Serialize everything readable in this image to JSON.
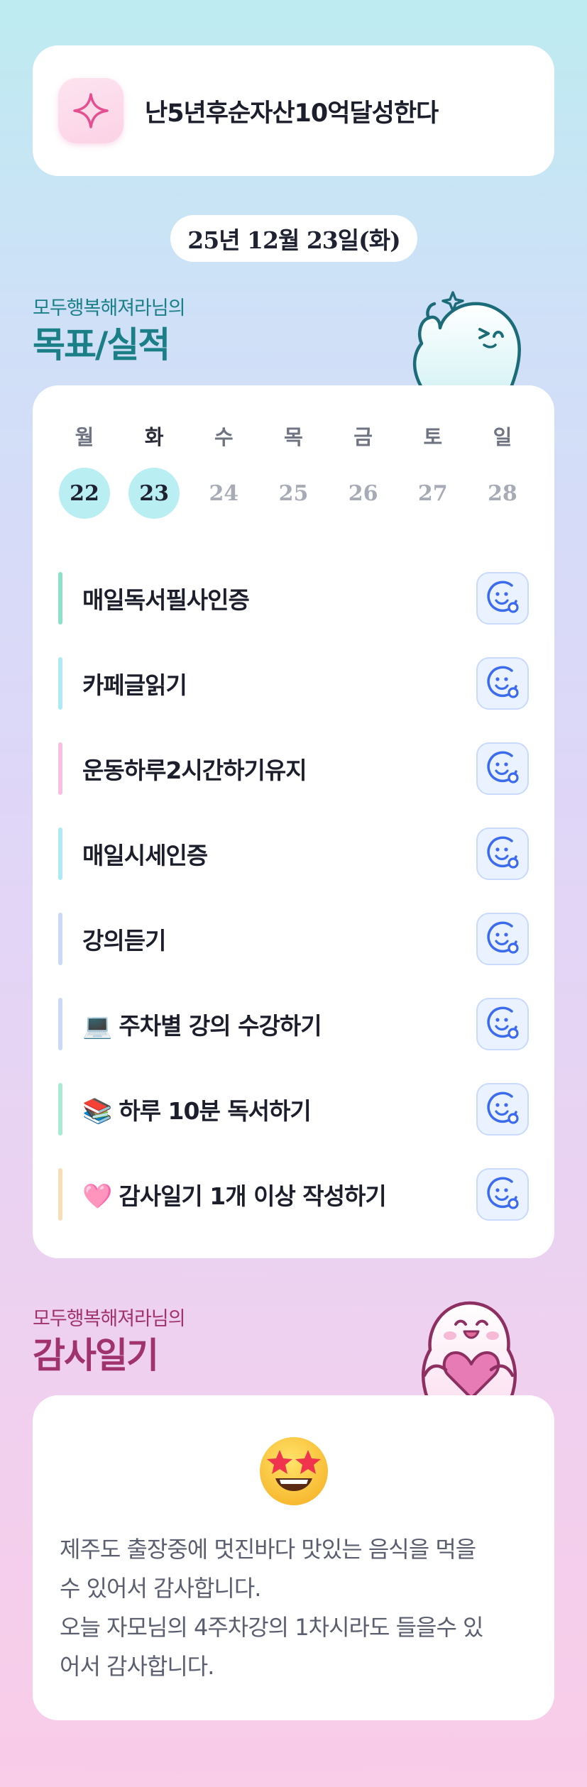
{
  "goal": {
    "title": "난5년후순자산10억달성한다",
    "icon": "sparkle-icon"
  },
  "date": "25년 12월 23일(화)",
  "goals_section": {
    "subtitle": "모두행복해져라님의",
    "title": "목표/실적"
  },
  "week": [
    {
      "day": "월",
      "date": "22",
      "done": true,
      "today": false
    },
    {
      "day": "화",
      "date": "23",
      "done": true,
      "today": true
    },
    {
      "day": "수",
      "date": "24",
      "done": false,
      "today": false
    },
    {
      "day": "목",
      "date": "25",
      "done": false,
      "today": false
    },
    {
      "day": "금",
      "date": "26",
      "done": false,
      "today": false
    },
    {
      "day": "토",
      "date": "27",
      "done": false,
      "today": false
    },
    {
      "day": "일",
      "date": "28",
      "done": false,
      "today": false
    }
  ],
  "goals": [
    {
      "emoji": "",
      "text": "매일독서필사인증",
      "color": "#8ee0c9"
    },
    {
      "emoji": "",
      "text": "카페글읽기",
      "color": "#aeeaf3"
    },
    {
      "emoji": "",
      "text": "운동하루2시간하기유지",
      "color": "#f7bfe0"
    },
    {
      "emoji": "",
      "text": "매일시세인증",
      "color": "#aeeaf3"
    },
    {
      "emoji": "",
      "text": "강의듣기",
      "color": "#c9d8f7"
    },
    {
      "emoji": "💻",
      "text": "주차별 강의 수강하기",
      "color": "#c9d8f7"
    },
    {
      "emoji": "📚",
      "text": "하루 10분 독서하기",
      "color": "#a8ebd0"
    },
    {
      "emoji": "🩷",
      "text": "감사일기 1개 이상 작성하기",
      "color": "#f6dfb6"
    }
  ],
  "gratitude_section": {
    "subtitle": "모두행복해져라님의",
    "title": "감사일기"
  },
  "gratitude": {
    "emoji": "star-struck-face-icon",
    "lines": [
      "제주도 출장중에 멋진바다 맛있는 음식을 먹을",
      "수 있어서 감사합니다.",
      "오늘 자모님의 4주차강의 1차시라도 들을수 있",
      "어서 감사합니다."
    ]
  },
  "colors": {
    "accent_teal": "#1a7f86",
    "accent_plum": "#a0336d",
    "done_circle": "#b9eef3",
    "check_icon": "#3b6cf0"
  }
}
